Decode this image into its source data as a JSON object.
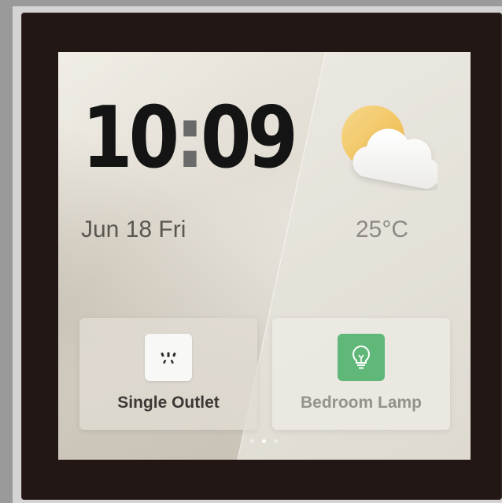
{
  "clock": {
    "hours": "10",
    "separator": ":",
    "minutes": "09"
  },
  "date": "Jun 18 Fri",
  "weather": {
    "icon": "partly-cloudy-icon",
    "temperature": "25°C"
  },
  "devices": [
    {
      "label": "Single Outlet",
      "icon": "power-outlet-icon",
      "state": "off",
      "icon_bg": "#f8f8f6"
    },
    {
      "label": "Bedroom Lamp",
      "icon": "lightbulb-icon",
      "state": "on",
      "icon_bg": "#5fb878"
    }
  ],
  "pagination": {
    "count": 3,
    "active_index": 1
  },
  "colors": {
    "bezel": "#221714",
    "lamp_on": "#5fb878",
    "sun": "#f2c86a"
  }
}
